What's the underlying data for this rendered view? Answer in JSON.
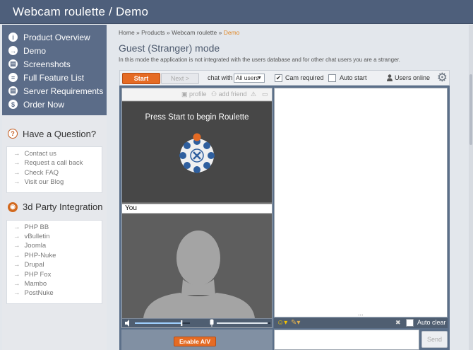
{
  "header": {
    "title": "Webcam roulette  /  Demo"
  },
  "nav": {
    "items": [
      {
        "label": "Product Overview",
        "icon": "i"
      },
      {
        "label": "Demo",
        "icon": "→"
      },
      {
        "label": "Screenshots",
        "icon": "▤"
      },
      {
        "label": "Full Feature List",
        "icon": "≡"
      },
      {
        "label": "Server Requirements",
        "icon": "▤"
      },
      {
        "label": "Order Now",
        "icon": "$"
      }
    ]
  },
  "question": {
    "title": "Have a Question?",
    "icon": "?",
    "links": [
      "Contact us",
      "Request a call back",
      "Check FAQ",
      "Visit our Blog"
    ]
  },
  "integration": {
    "title": "3d Party Integration",
    "links": [
      "PHP BB",
      "vBulletin",
      "Joomla",
      "PHP-Nuke",
      "Drupal",
      "PHP Fox",
      "Mambo",
      "PostNuke"
    ]
  },
  "breadcrumb": {
    "home": "Home",
    "products": "Products",
    "section": "Webcam roulette",
    "current": "Demo",
    "sep": " » "
  },
  "page": {
    "title": "Guest (Stranger) mode",
    "description": "In this mode the application is not integrated with the users database and for other chat users you are a stranger."
  },
  "toolbar": {
    "start": "Start",
    "next": "Next >",
    "chat_with": "chat with",
    "chat_with_value": "All users",
    "cam_required": "Cam required",
    "cam_required_checked": true,
    "auto_start": "Auto start",
    "auto_start_checked": false,
    "users_online": "Users online"
  },
  "pane": {
    "profile": "profile",
    "add_friend": "add friend",
    "press_start": "Press Start to begin Roulette",
    "you": "You"
  },
  "chat": {
    "ellipsis": "...",
    "auto_clear": "Auto clear",
    "send": "Send"
  },
  "controls": {
    "enable_av": "Enable A/V",
    "volume_level": 0.85,
    "mic_level": 0.95
  },
  "colors": {
    "accent": "#e56b24",
    "nav_bg": "#5b6c88",
    "header_bg": "#4e5f7b"
  }
}
